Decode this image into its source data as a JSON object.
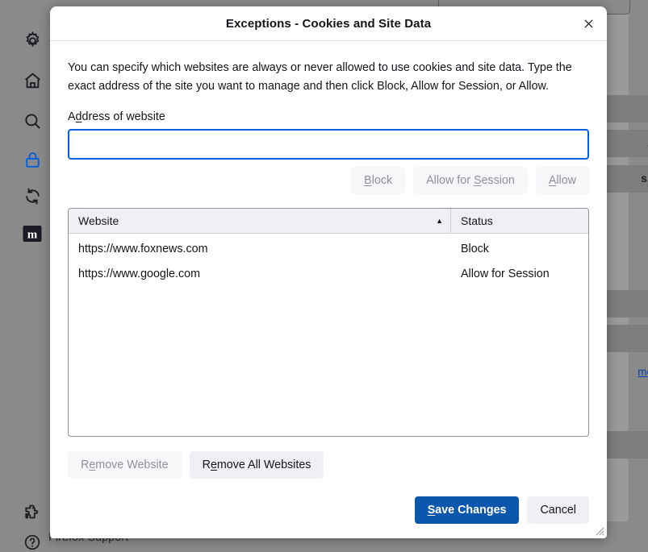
{
  "background": {
    "sidebar_icons": [
      {
        "name": "gear-icon",
        "label": "General settings"
      },
      {
        "name": "home-icon",
        "label": "Home"
      },
      {
        "name": "search-icon",
        "label": "Search"
      },
      {
        "name": "lock-icon",
        "label": "Privacy & Security"
      },
      {
        "name": "sync-icon",
        "label": "Sync"
      },
      {
        "name": "mozilla-m-icon",
        "label": "More from Mozilla"
      },
      {
        "name": "extensions-puzzle-icon",
        "label": "Extensions & Themes"
      },
      {
        "name": "help-question-icon",
        "label": "Firefox Support"
      }
    ],
    "partial_buttons": [
      "",
      "...",
      "s...",
      "",
      ".",
      ".."
    ],
    "more_link": "more",
    "support_text": "Firefox Support"
  },
  "dialog": {
    "title": "Exceptions - Cookies and Site Data",
    "close_label": "×",
    "intro": "You can specify which websites are always or never allowed to use cookies and site data. Type the exact address of the site you want to manage and then click Block, Allow for Session, or Allow.",
    "address": {
      "label_prefix": "A",
      "label_accesskey": "d",
      "label_suffix": "dress of website",
      "value": "",
      "placeholder": ""
    },
    "permission_buttons": [
      {
        "name": "block-button",
        "prefix": "",
        "accesskey": "B",
        "suffix": "lock",
        "disabled": true
      },
      {
        "name": "allow-for-session-button",
        "prefix": "Allow for ",
        "accesskey": "S",
        "suffix": "ession",
        "disabled": true
      },
      {
        "name": "allow-button",
        "prefix": "",
        "accesskey": "A",
        "suffix": "llow",
        "disabled": true
      }
    ],
    "table": {
      "columns": [
        {
          "name": "website-column",
          "label": "Website",
          "sort": "ascending",
          "sort_glyph": "▲"
        },
        {
          "name": "status-column",
          "label": "Status",
          "sort": "none",
          "sort_glyph": ""
        }
      ],
      "rows": [
        {
          "website": "https://www.foxnews.com",
          "status": "Block"
        },
        {
          "website": "https://www.google.com",
          "status": "Allow for Session"
        }
      ]
    },
    "remove_buttons": [
      {
        "name": "remove-website-button",
        "prefix": "R",
        "accesskey": "e",
        "suffix": "move Website",
        "disabled": true
      },
      {
        "name": "remove-all-websites-button",
        "prefix": "R",
        "accesskey": "e",
        "suffix": "move All Websites",
        "disabled": false
      }
    ],
    "footer_buttons": [
      {
        "name": "save-changes-button",
        "prefix": "",
        "accesskey": "S",
        "suffix": "ave Changes",
        "primary": true
      },
      {
        "name": "cancel-button",
        "prefix": "Cancel",
        "accesskey": "",
        "suffix": "",
        "primary": false
      }
    ]
  },
  "colors": {
    "accent": "#0b57ae",
    "focus_border": "#0060df",
    "active_icon": "#0060df",
    "link": "#0a3fa8",
    "overlay": "#8a8a8a"
  }
}
